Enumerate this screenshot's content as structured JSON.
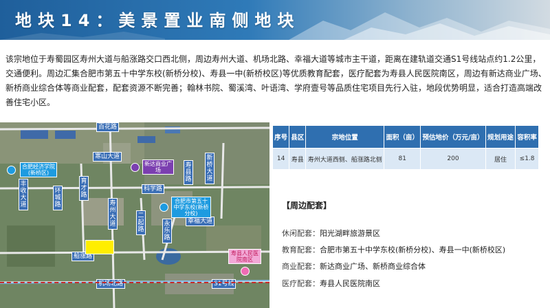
{
  "header": {
    "title": "地块14：美景置业南侧地块"
  },
  "intro": "该宗地位于寿蜀园区寿州大道与船涨路交口西北侧，周边寿州大道、机场北路、幸福大道等城市主干道，距离在建轨道交通S1号线站点约1.2公里，交通便利。周边汇集合肥市第五十中学东校(新桥分校)、寿县一中(新桥校区)等优质教育配套，医疗配套为寿县人民医院南区，周边有新达商业广场、新桥商业综合体等商业配套，配套资源不断完善；翰林书院、蜀溪湾、叶语湾、学府壹号等品质住宅项目先行入驻，地段优势明显，适合打造高端改善住宅小区。",
  "map": {
    "roads": {
      "baihua": "百花路",
      "hanshan": "寒山大道",
      "xinqiao": "新桥大道",
      "shouxian": "寿县路",
      "kexue": "科学路",
      "shouzhou": "寿州大道",
      "yongle": "永乐路",
      "xingfu": "幸福大道",
      "erqi": "二起路",
      "fengshou": "丰收大道",
      "huanlu": "环城路",
      "yucai": "育才路",
      "chuanzhang": "船涨路",
      "jichang": "机场北路",
      "s1": "S1号线"
    },
    "pois": {
      "school1": "合肥经济学院(新桥区)",
      "mall": "新达商业广场",
      "school2": "合肥市第五十中学东校(新桥分校)",
      "hospital": "寿县人民医院南区"
    }
  },
  "table": {
    "headers": [
      "序号",
      "县区",
      "宗地位置",
      "面积（亩）",
      "预估地价（万元/亩）",
      "规划用途",
      "容积率"
    ],
    "rows": [
      [
        "14",
        "寿县",
        "寿州大道西侧、船涨路北侧",
        "81",
        "200",
        "居住",
        "≤1.8"
      ]
    ]
  },
  "facilities": {
    "title": "【周边配套】",
    "items": [
      {
        "label": "休闲配套：",
        "value": "阳光湖畔旅游景区"
      },
      {
        "label": "教育配套：",
        "value": "合肥市第五十中学东校(新桥分校)、寿县一中(新桥校区)"
      },
      {
        "label": "商业配套：",
        "value": "新达商业广场、新桥商业综合体"
      },
      {
        "label": "医疗配套：",
        "value": "寿县人民医院南区"
      }
    ]
  },
  "colors": {
    "banner": "#2f7ab8",
    "table_header": "#2f6fb0",
    "table_row": "#dbe8f5",
    "lot": "#ffee00",
    "road_label": "#3b6fb6"
  }
}
